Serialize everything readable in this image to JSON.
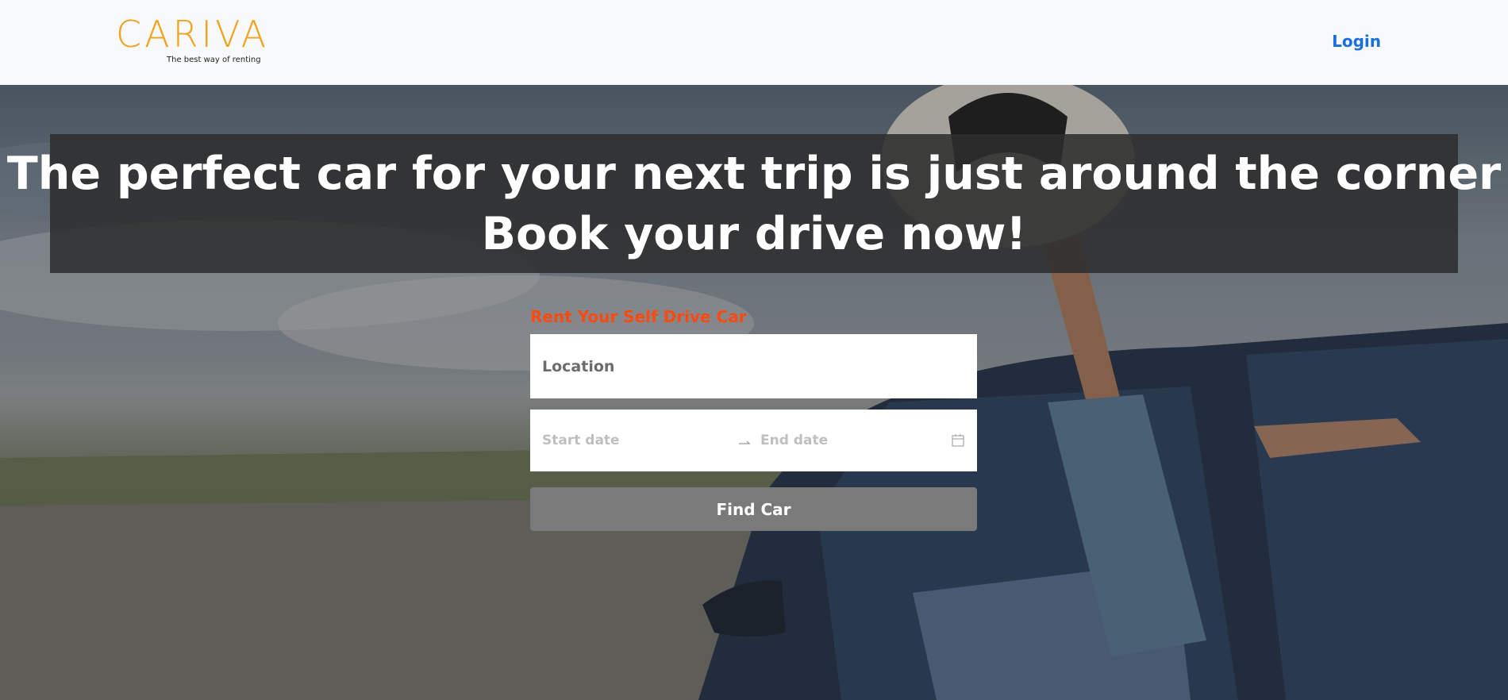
{
  "brand": {
    "name": "CARIVA",
    "tagline": "The best way of renting",
    "color": "#f0a21c"
  },
  "nav": {
    "login_label": "Login",
    "link_color": "#1a6fe0"
  },
  "hero": {
    "headline_line1": "The perfect car for your next trip is just around the corner",
    "headline_line2": "Book your drive now!"
  },
  "search": {
    "title": "Rent Your Self Drive Car",
    "title_color": "#ff4a0f",
    "location_placeholder": "Location",
    "start_date_placeholder": "Start date",
    "end_date_placeholder": "End date",
    "submit_label": "Find Car"
  },
  "icons": {
    "date_separator": "swap-right-icon",
    "calendar": "calendar-icon"
  }
}
